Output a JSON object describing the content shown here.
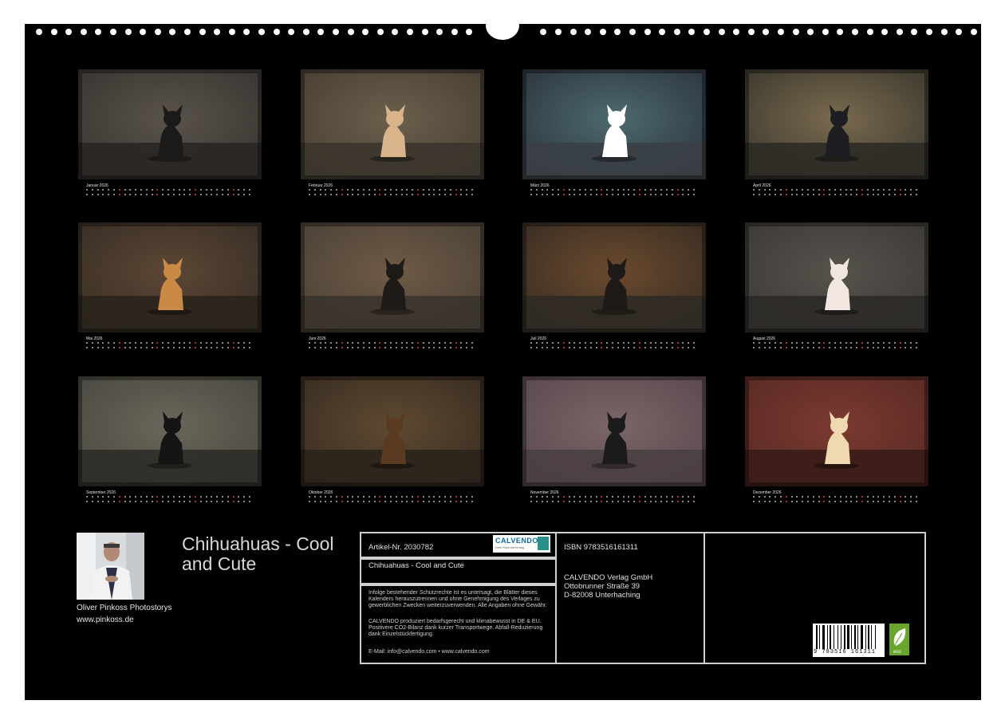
{
  "calendar": {
    "title": "Chihuahuas - Cool and Cute",
    "author_name": "Oliver Pinkoss Photostorys",
    "author_url": "www.pinkoss.de"
  },
  "months": [
    {
      "label": "Januar 2026"
    },
    {
      "label": "Februar 2026"
    },
    {
      "label": "März 2026"
    },
    {
      "label": "April 2026"
    },
    {
      "label": "Mai 2026"
    },
    {
      "label": "Juni 2026"
    },
    {
      "label": "Juli 2026"
    },
    {
      "label": "August 2026"
    },
    {
      "label": "September 2026"
    },
    {
      "label": "Oktober 2026"
    },
    {
      "label": "November 2026"
    },
    {
      "label": "Dezember 2026"
    }
  ],
  "imprint": {
    "article_no": "Artikel-Nr. 2030782",
    "brand": "CALVENDO",
    "brand_sub": "Dein Kalenderverlag",
    "product_title": "Chihuahuas - Cool and Cute",
    "legal_1": "Infolge bestehender Schutzrechte ist es untersagt, die Blätter dieses Kalenders herauszutrennen und ohne Genehmigung des Verlages zu gewerblichen Zwecken weiterzuverwenden. Alle Angaben ohne Gewähr.",
    "legal_2": "CALVENDO produziert bedarfsgerecht und klimabewusst in DE & EU. Positivere CO2-Bilanz dank kurzer Transportwege. Abfall-Reduzierung dank Einzelstückfertigung.",
    "contact": "E-Mail: info@calvendo.com • www.calvendo.com",
    "isbn": "ISBN 9783516161311",
    "publisher_name": "CALVENDO Verlag GmbH",
    "publisher_street": "Ottobrunner Straße 39",
    "publisher_city": "D-82008 Unterhaching",
    "barcode_digits": "9 783516 161311",
    "eco_label": "eco"
  },
  "colors": {
    "background": "#000000",
    "frame": "#cfcfcf",
    "text": "#e0e0e0"
  }
}
